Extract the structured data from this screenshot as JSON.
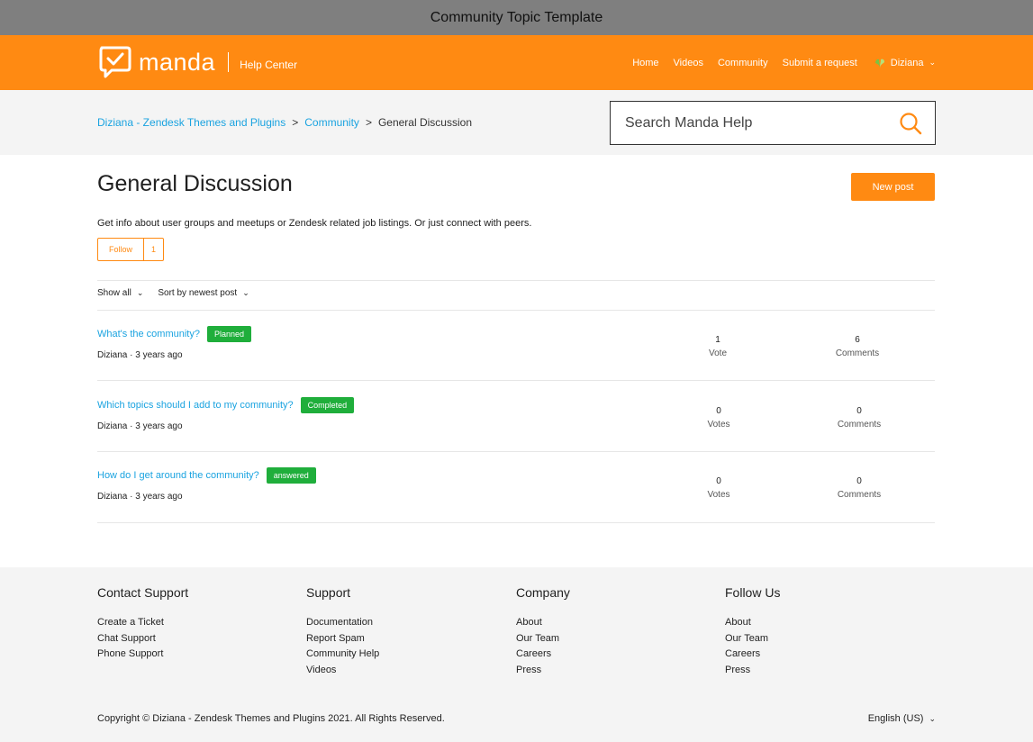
{
  "window": {
    "title": "Community Topic Template"
  },
  "brand": {
    "name": "manda",
    "subtitle": "Help Center",
    "accent": "#ff8a12",
    "link_color": "#1aa3e0",
    "badge_color": "#1fae3b"
  },
  "nav": {
    "items": [
      "Home",
      "Videos",
      "Community",
      "Submit a request"
    ],
    "user": "Diziana"
  },
  "breadcrumb": {
    "items": [
      "Diziana - Zendesk Themes and Plugins",
      "Community"
    ],
    "separator": ">",
    "current": "General Discussion"
  },
  "search": {
    "placeholder": "Search Manda Help"
  },
  "topic": {
    "title": "General Discussion",
    "new_post_label": "New post",
    "description": "Get info about user groups and meetups or Zendesk related job listings. Or just connect with peers.",
    "follow_label": "Follow",
    "follow_count": "1"
  },
  "filters": {
    "show": "Show all",
    "sort": "Sort by newest post"
  },
  "posts": [
    {
      "title": "What's the community?",
      "badge": "Planned",
      "author": "Diziana",
      "dot": "·",
      "age": "3 years ago",
      "votes": "1",
      "votes_label": "Vote",
      "comments": "6",
      "comments_label": "Comments"
    },
    {
      "title": "Which topics should I add to my community?",
      "badge": "Completed",
      "author": "Diziana",
      "dot": "·",
      "age": "3 years ago",
      "votes": "0",
      "votes_label": "Votes",
      "comments": "0",
      "comments_label": "Comments"
    },
    {
      "title": "How do I get around the community?",
      "badge": "answered",
      "author": "Diziana",
      "dot": "·",
      "age": "3 years ago",
      "votes": "0",
      "votes_label": "Votes",
      "comments": "0",
      "comments_label": "Comments"
    }
  ],
  "footer": {
    "columns": [
      {
        "heading": "Contact Support",
        "links": [
          "Create a Ticket",
          "Chat Support",
          "Phone Support"
        ]
      },
      {
        "heading": "Support",
        "links": [
          "Documentation",
          "Report Spam",
          "Community Help",
          "Videos"
        ]
      },
      {
        "heading": "Company",
        "links": [
          "About",
          "Our Team",
          "Careers",
          "Press"
        ]
      },
      {
        "heading": "Follow Us",
        "links": [
          "About",
          "Our Team",
          "Careers",
          "Press"
        ]
      }
    ],
    "copyright": "Copyright © Diziana - Zendesk Themes and Plugins 2021. All Rights Reserved.",
    "language": "English (US)"
  }
}
